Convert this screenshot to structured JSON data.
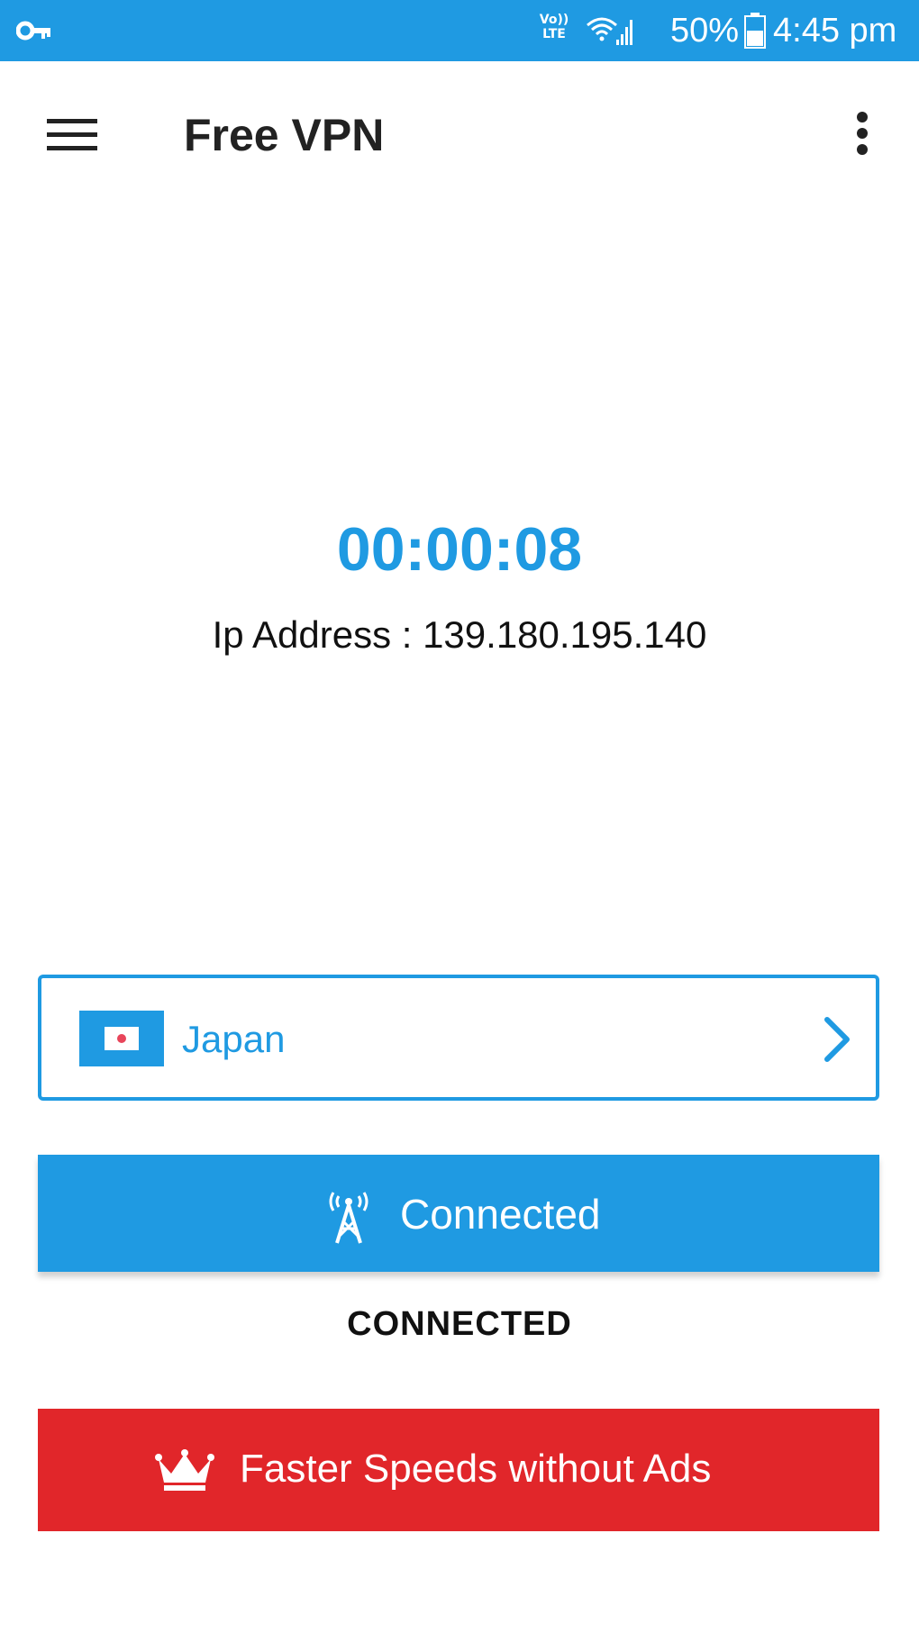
{
  "status_bar": {
    "volte_top": "Vo))",
    "volte_bottom": "LTE",
    "battery": "50%",
    "time": "4:45 pm",
    "icons": [
      "vpn-key-icon",
      "wifi-icon",
      "signal-icon",
      "battery-icon"
    ]
  },
  "app_bar": {
    "title": "Free VPN",
    "icons": [
      "hamburger-menu-icon",
      "more-vert-icon"
    ]
  },
  "main": {
    "timer": "00:00:08",
    "ip_address": "Ip Address : 139.180.195.140"
  },
  "country": {
    "name": "Japan",
    "icons": [
      "japan-flag-icon",
      "chevron-right-icon"
    ]
  },
  "connect_button": {
    "label": "Connected",
    "icon": "signal-tower-icon"
  },
  "connection_status": "CONNECTED",
  "premium_button": {
    "label": "Faster Speeds without Ads",
    "icon": "crown-icon"
  },
  "colors": {
    "primary": "#1f9ae2",
    "premium": "#e1262a",
    "flag_red": "#e8455a"
  }
}
